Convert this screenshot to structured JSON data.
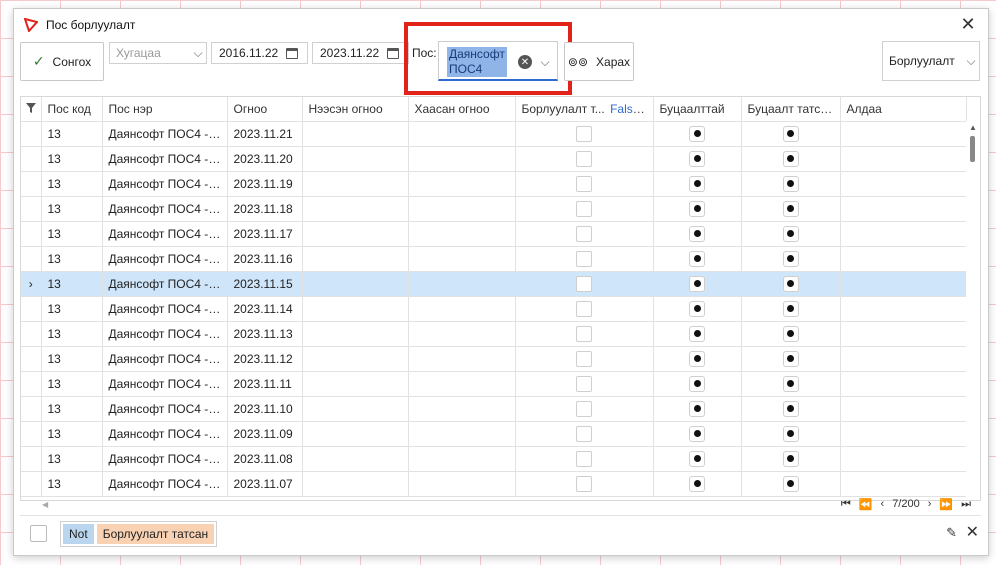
{
  "window": {
    "title": "Пос борлуулалт"
  },
  "toolbar": {
    "select_label": "Сонгох",
    "period_placeholder": "Хугацаа",
    "date_from": "2016.11.22",
    "date_to": "2023.11.22",
    "pos_label": "Пос:",
    "pos_value_line1": "Даянсофт",
    "pos_value_line2": "ПОС4",
    "view_label": "Харах",
    "status_value": "Борлуулалт"
  },
  "grid": {
    "columns": [
      "Пос код",
      "Пос нэр",
      "Огноо",
      "Нээсэн огноо",
      "Хаасан огноо",
      "Борлуулалт т...",
      "Буцаалттай",
      "Буцаалт татсан",
      "Алдаа"
    ],
    "filter_tag": "False",
    "selected_row": 6,
    "rows": [
      {
        "code": "13",
        "name": "Даянсофт ПОС4 - (...",
        "date": "2023.11.21"
      },
      {
        "code": "13",
        "name": "Даянсофт ПОС4 - (...",
        "date": "2023.11.20"
      },
      {
        "code": "13",
        "name": "Даянсофт ПОС4 - (...",
        "date": "2023.11.19"
      },
      {
        "code": "13",
        "name": "Даянсофт ПОС4 - (...",
        "date": "2023.11.18"
      },
      {
        "code": "13",
        "name": "Даянсофт ПОС4 - (...",
        "date": "2023.11.17"
      },
      {
        "code": "13",
        "name": "Даянсофт ПОС4 - (...",
        "date": "2023.11.16"
      },
      {
        "code": "13",
        "name": "Даянсофт ПОС4 - (...",
        "date": "2023.11.15"
      },
      {
        "code": "13",
        "name": "Даянсофт ПОС4 - (...",
        "date": "2023.11.14"
      },
      {
        "code": "13",
        "name": "Даянсофт ПОС4 - (...",
        "date": "2023.11.13"
      },
      {
        "code": "13",
        "name": "Даянсофт ПОС4 - (...",
        "date": "2023.11.12"
      },
      {
        "code": "13",
        "name": "Даянсофт ПОС4 - (...",
        "date": "2023.11.11"
      },
      {
        "code": "13",
        "name": "Даянсофт ПОС4 - (...",
        "date": "2023.11.10"
      },
      {
        "code": "13",
        "name": "Даянсофт ПОС4 - (...",
        "date": "2023.11.09"
      },
      {
        "code": "13",
        "name": "Даянсофт ПОС4 - (...",
        "date": "2023.11.08"
      },
      {
        "code": "13",
        "name": "Даянсофт ПОС4 - (...",
        "date": "2023.11.07"
      }
    ]
  },
  "pager": {
    "position": "7/200"
  },
  "filter_panel": {
    "not_label": "Not",
    "value_label": "Борлуулалт татсан"
  },
  "colors": {
    "highlight": "#e2231a",
    "selected_row": "#cfe5fa",
    "accent": "#2f6ad0"
  },
  "icons": [
    "app-logo-icon",
    "close-icon",
    "check-icon",
    "chevron-down-icon",
    "calendar-icon",
    "clear-icon",
    "binoculars-icon",
    "filter-icon",
    "edit-icon"
  ]
}
